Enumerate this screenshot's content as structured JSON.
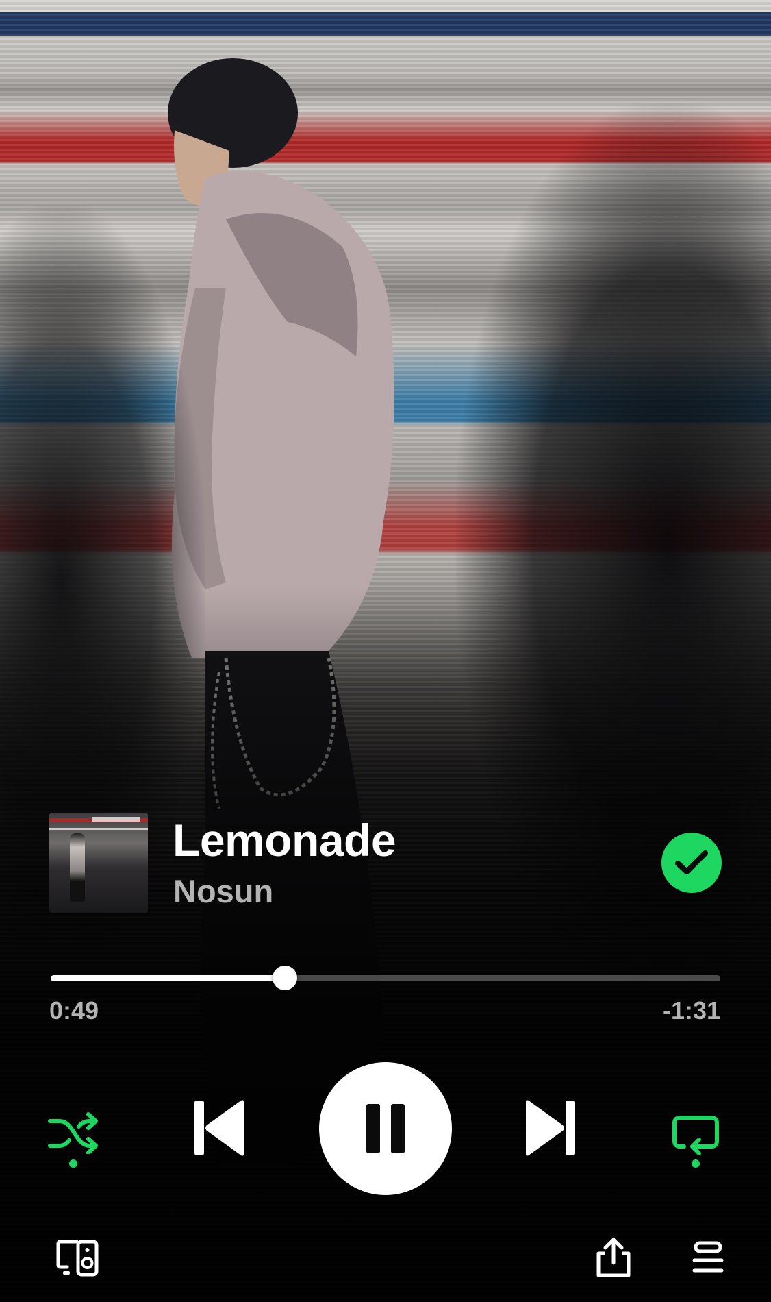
{
  "track": {
    "title": "Lemonade",
    "artist": "Nosun",
    "liked": true
  },
  "playback": {
    "elapsed": "0:49",
    "remaining": "-1:31",
    "progress_fraction": 0.35,
    "is_playing": true,
    "shuffle_enabled": true,
    "repeat_enabled": true
  },
  "icons": {
    "liked": "checkmark-icon",
    "shuffle": "shuffle-icon",
    "previous": "skip-previous-icon",
    "play_pause": "pause-icon",
    "next": "skip-next-icon",
    "repeat": "repeat-icon",
    "devices": "connect-device-icon",
    "share": "share-icon",
    "queue": "queue-icon"
  },
  "colors": {
    "accent": "#1ed760",
    "primary_text": "#ffffff",
    "secondary_text": "#b3b3b3",
    "background": "#0b0b0c"
  }
}
